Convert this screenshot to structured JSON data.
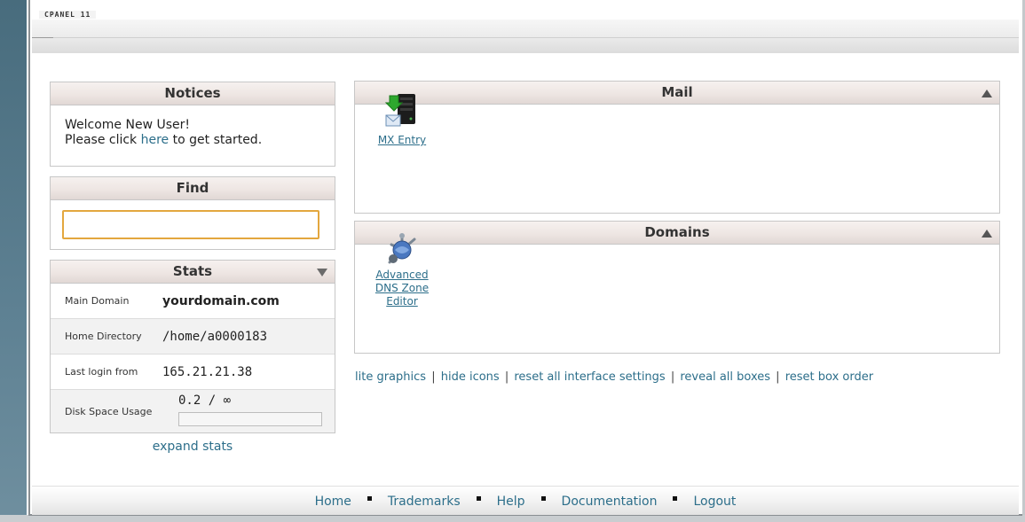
{
  "brand": "CPANEL 11",
  "notices": {
    "title": "Notices",
    "line1": "Welcome New User!",
    "line2_pre": "Please click ",
    "line2_link": "here",
    "line2_post": " to get started."
  },
  "find": {
    "title": "Find",
    "value": "",
    "placeholder": ""
  },
  "stats": {
    "title": "Stats",
    "toggle_icon": "triangle-down-icon",
    "rows": [
      {
        "label": "Main Domain",
        "value": "yourdomain.com"
      },
      {
        "label": "Home Directory",
        "value": "/home/a0000183"
      },
      {
        "label": "Last login from",
        "value": "165.21.21.38"
      },
      {
        "label": "Disk Space Usage",
        "value": "0.2 / ∞"
      }
    ],
    "disk_fill_fraction": 0,
    "expand_label": "expand stats"
  },
  "mail": {
    "title": "Mail",
    "toggle_icon": "triangle-up-icon",
    "tools": [
      {
        "label": "MX Entry",
        "icon": "mx-entry-icon"
      }
    ]
  },
  "domains": {
    "title": "Domains",
    "toggle_icon": "triangle-up-icon",
    "tools": [
      {
        "label": "Advanced DNS Zone Editor",
        "icon": "dns-zone-editor-icon"
      }
    ]
  },
  "links": {
    "lite_graphics": "lite graphics",
    "hide_icons": "hide icons",
    "reset_all": "reset all interface settings",
    "reveal_all": "reveal all boxes",
    "reset_order": "reset box order",
    "separator": "|"
  },
  "footer": {
    "items": [
      "Home",
      "Trademarks",
      "Help",
      "Documentation",
      "Logout"
    ]
  },
  "colors": {
    "link": "#2c6e8a",
    "input_focus_border": "#e3a73e",
    "sidebar": "#5b7d8f"
  }
}
